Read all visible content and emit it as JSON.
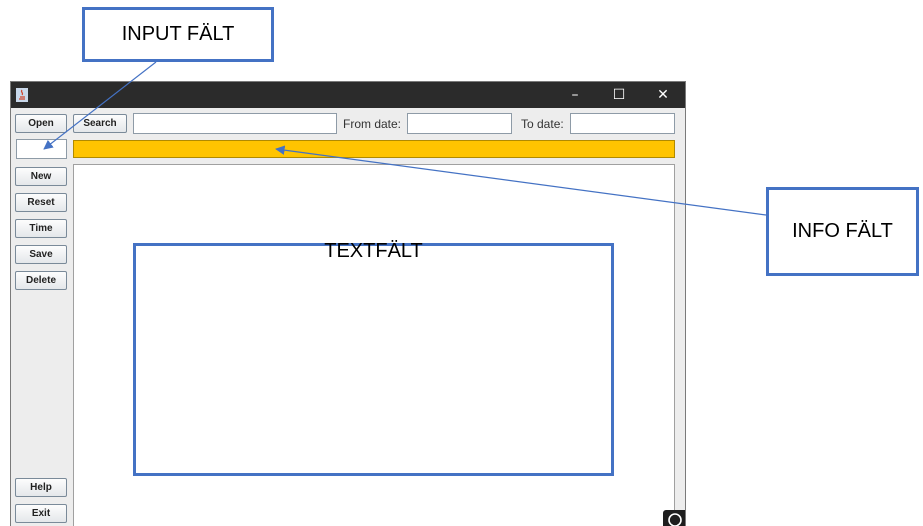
{
  "callouts": {
    "input_label": "INPUT FÄLT",
    "info_label": "INFO FÄLT",
    "text_label": "TEXTFÄLT",
    "color": "#4472c4"
  },
  "window": {
    "app_icon": "java-icon",
    "controls": {
      "minimize": "–",
      "maximize": "☐",
      "close": "✕"
    }
  },
  "toolbar": {
    "open_label": "Open",
    "search_label": "Search",
    "search_value": "",
    "from_date_label": "From date:",
    "from_date_value": "",
    "to_date_label": "To date:",
    "to_date_value": ""
  },
  "input_field": {
    "value": ""
  },
  "info_field": {
    "color": "#ffc400",
    "text": ""
  },
  "sidebar": {
    "new_label": "New",
    "reset_label": "Reset",
    "time_label": "Time",
    "save_label": "Save",
    "delete_label": "Delete",
    "help_label": "Help",
    "exit_label": "Exit"
  },
  "text_area": {
    "content": ""
  }
}
